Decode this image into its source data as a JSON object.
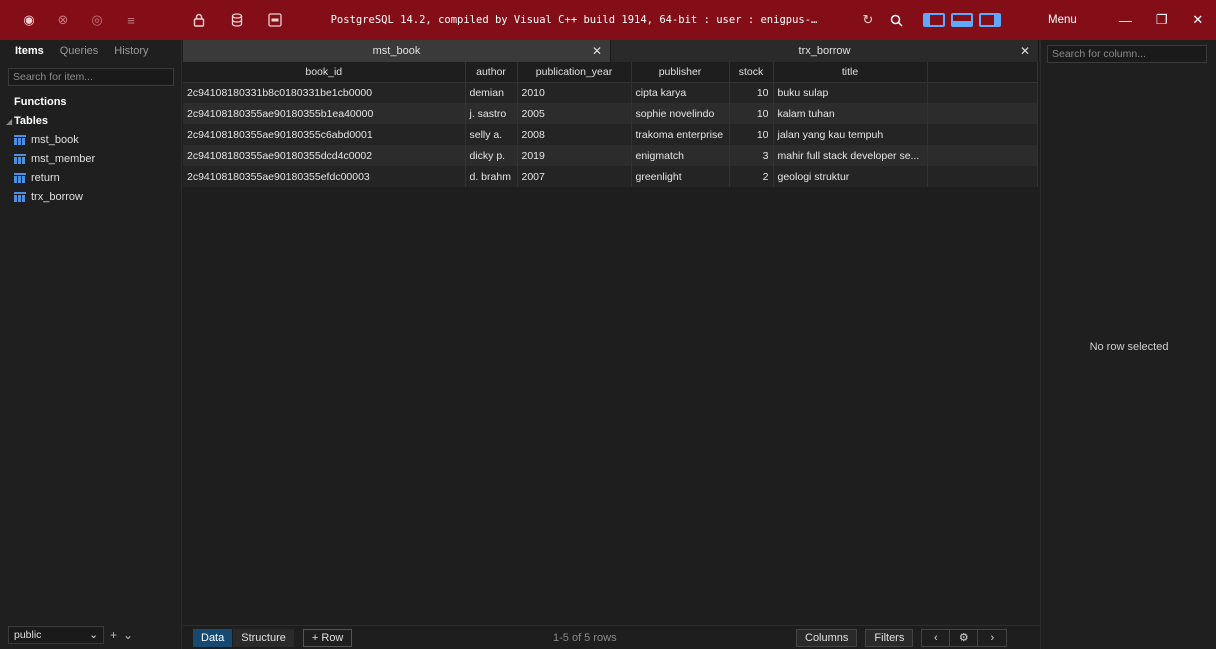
{
  "titlebar": {
    "status": "PostgreSQL 14.2, compiled by Visual C++ build 1914, 64-bit : user : enigpus-…",
    "menu_label": "Menu",
    "icons_left": [
      "power-icon",
      "close-circle-icon",
      "eye-icon",
      "list-icon"
    ],
    "icons_tools": [
      "lock-icon",
      "database-icon",
      "sql-icon"
    ],
    "icons_right": [
      "refresh-icon",
      "search-icon"
    ],
    "window_controls": [
      "minimize",
      "restore",
      "close"
    ]
  },
  "sidebar": {
    "tabs": [
      "Items",
      "Queries",
      "History"
    ],
    "active_tab": "Items",
    "search_placeholder": "Search for item...",
    "functions_label": "Functions",
    "tables_label": "Tables",
    "tables": [
      "mst_book",
      "mst_member",
      "return",
      "trx_borrow"
    ],
    "schema": "public"
  },
  "tabs": [
    {
      "label": "mst_book",
      "active": true
    },
    {
      "label": "trx_borrow",
      "active": false
    }
  ],
  "grid": {
    "columns": [
      "book_id",
      "author",
      "publication_year",
      "publisher",
      "stock",
      "title"
    ],
    "rows": [
      [
        "2c94108180331b8c0180331be1cb0000",
        "demian",
        "2010",
        "cipta karya",
        "10",
        "buku sulap"
      ],
      [
        "2c94108180355ae90180355b1ea40000",
        "j. sastro",
        "2005",
        "sophie novelindo",
        "10",
        "kalam tuhan"
      ],
      [
        "2c94108180355ae90180355c6abd0001",
        "selly a.",
        "2008",
        "trakoma enterprise",
        "10",
        "jalan yang kau tempuh"
      ],
      [
        "2c94108180355ae90180355dcd4c0002",
        "dicky p.",
        "2019",
        "enigmatch",
        "3",
        "mahir full stack developer se..."
      ],
      [
        "2c94108180355ae90180355efdc00003",
        "d. brahm",
        "2007",
        "greenlight",
        "2",
        "geologi struktur"
      ]
    ]
  },
  "bottom": {
    "data_label": "Data",
    "structure_label": "Structure",
    "row_label": "+ Row",
    "count": "1-5 of 5 rows",
    "columns_label": "Columns",
    "filters_label": "Filters"
  },
  "right_panel": {
    "search_placeholder": "Search for column...",
    "empty_text": "No row selected"
  },
  "colors": {
    "titlebar": "#830e18",
    "accent": "#5fa8ff",
    "active_button": "#164a72"
  }
}
